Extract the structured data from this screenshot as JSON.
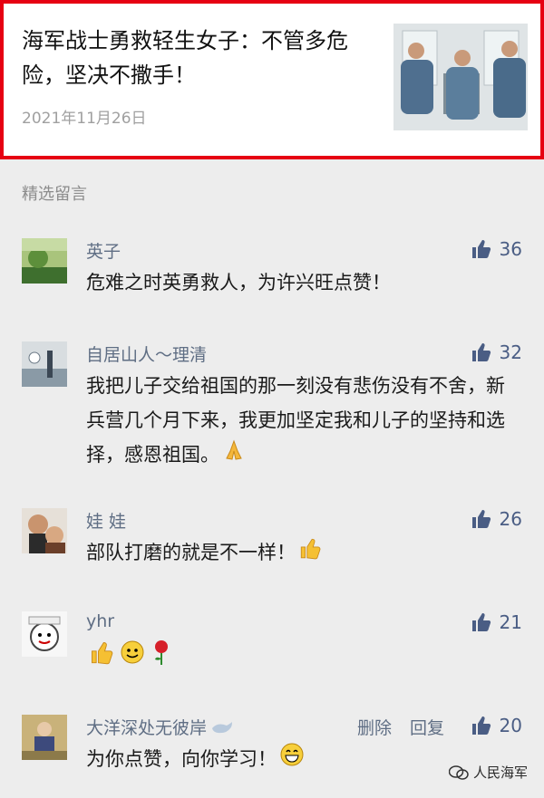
{
  "article": {
    "title": "海军战士勇救轻生女子：不管多危险，坚决不撒手！",
    "date": "2021年11月26日"
  },
  "section_label": "精选留言",
  "comments": [
    {
      "nickname": "英子",
      "likes": "36",
      "text": "危难之时英勇救人，为许兴旺点赞！",
      "avatar_icon": "landscape-avatar-icon"
    },
    {
      "nickname": "自居山人～理清",
      "likes": "32",
      "text": "我把儿子交给祖国的那一刻没有悲伤没有不舍，新兵营几个月下来，我更加坚定我和儿子的坚持和选择，感恩祖国。",
      "emoji": "pray-emoji",
      "avatar_icon": "scenery-avatar-icon"
    },
    {
      "nickname": "娃 娃",
      "likes": "26",
      "text": "部队打磨的就是不一样！",
      "emoji": "thumbs-up-emoji",
      "avatar_icon": "photo-avatar-icon"
    },
    {
      "nickname": "yhr",
      "likes": "21",
      "text": "",
      "emojis": [
        "thumbs-up-emoji",
        "smile-emoji",
        "rose-emoji"
      ],
      "avatar_icon": "cartoon-avatar-icon"
    },
    {
      "nickname": "大洋深处无彼岸",
      "likes": "20",
      "text": "为你点赞，向你学习！",
      "emoji": "grin-emoji",
      "avatar_icon": "portrait-avatar-icon",
      "delete_label": "删除",
      "reply_label": "回复"
    }
  ],
  "watermark": "人民海军",
  "colors": {
    "border": "#e60012",
    "nickname": "#5f6e84",
    "like": "#4a5d84",
    "background": "#ededed"
  }
}
